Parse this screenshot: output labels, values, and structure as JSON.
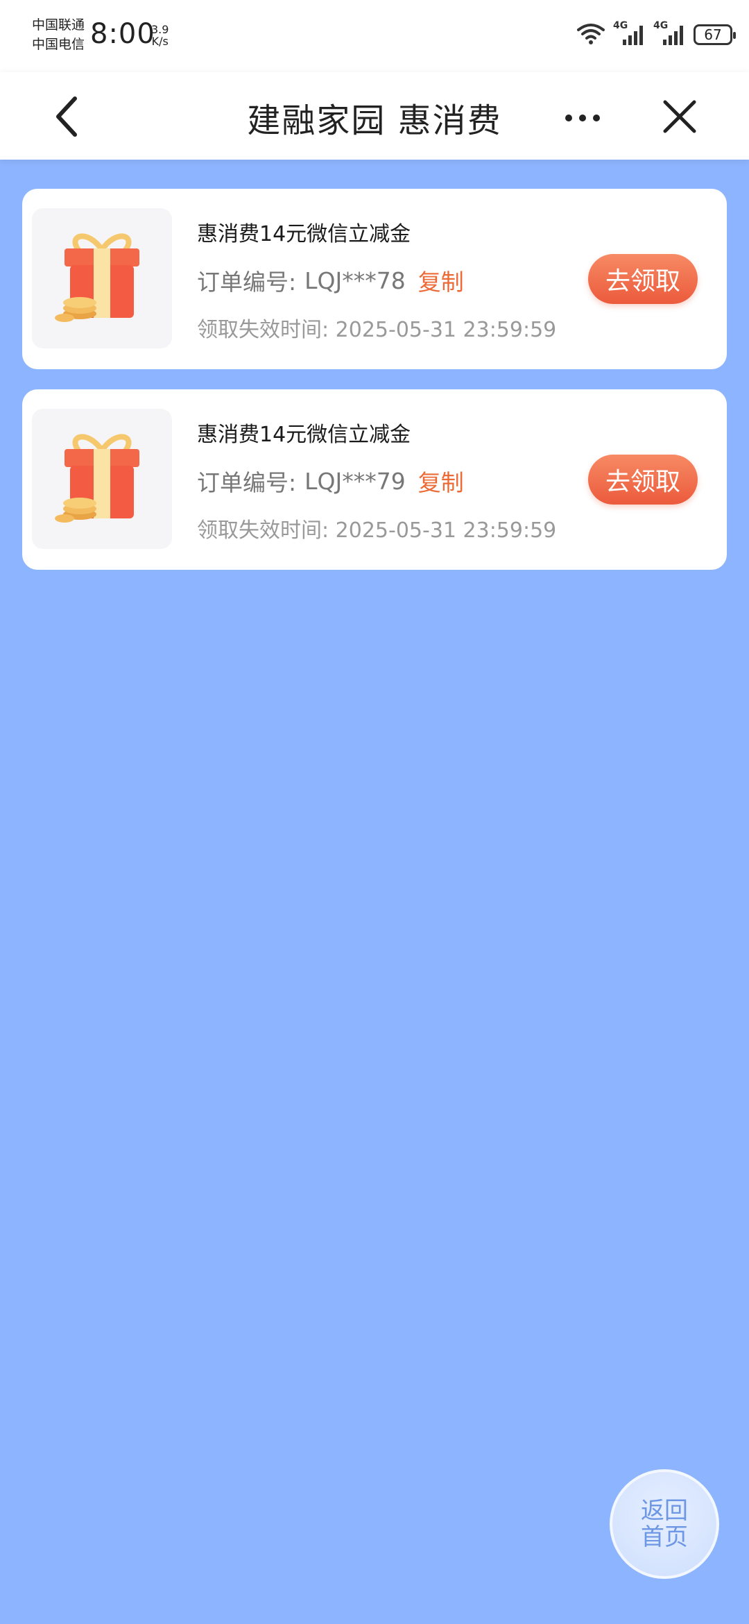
{
  "status_bar": {
    "carrier_1": "中国联通",
    "carrier_2": "中国电信",
    "time": "8:00",
    "speed_value": "3.9",
    "speed_unit": "K/s",
    "signal_1_label": "4G",
    "signal_2_label": "4G",
    "battery": "67"
  },
  "header": {
    "title": "建融家园 惠消费"
  },
  "vouchers": [
    {
      "title": "惠消费14元微信立减金",
      "order_label": "订单编号:",
      "order_no": "LQJ***78",
      "copy_label": "复制",
      "expire": "领取失效时间: 2025-05-31 23:59:59",
      "claim_label": "去领取"
    },
    {
      "title": "惠消费14元微信立减金",
      "order_label": "订单编号:",
      "order_no": "LQJ***79",
      "copy_label": "复制",
      "expire": "领取失效时间: 2025-05-31 23:59:59",
      "claim_label": "去领取"
    }
  ],
  "fab": {
    "line1": "返回",
    "line2": "首页"
  },
  "colors": {
    "background": "#8db4fe",
    "accent": "#ec6a35",
    "button": "#eb5a3c"
  },
  "icons": [
    "back-arrow-icon",
    "more-dots-icon",
    "close-icon",
    "wifi-icon",
    "signal-icon",
    "gift-icon"
  ]
}
